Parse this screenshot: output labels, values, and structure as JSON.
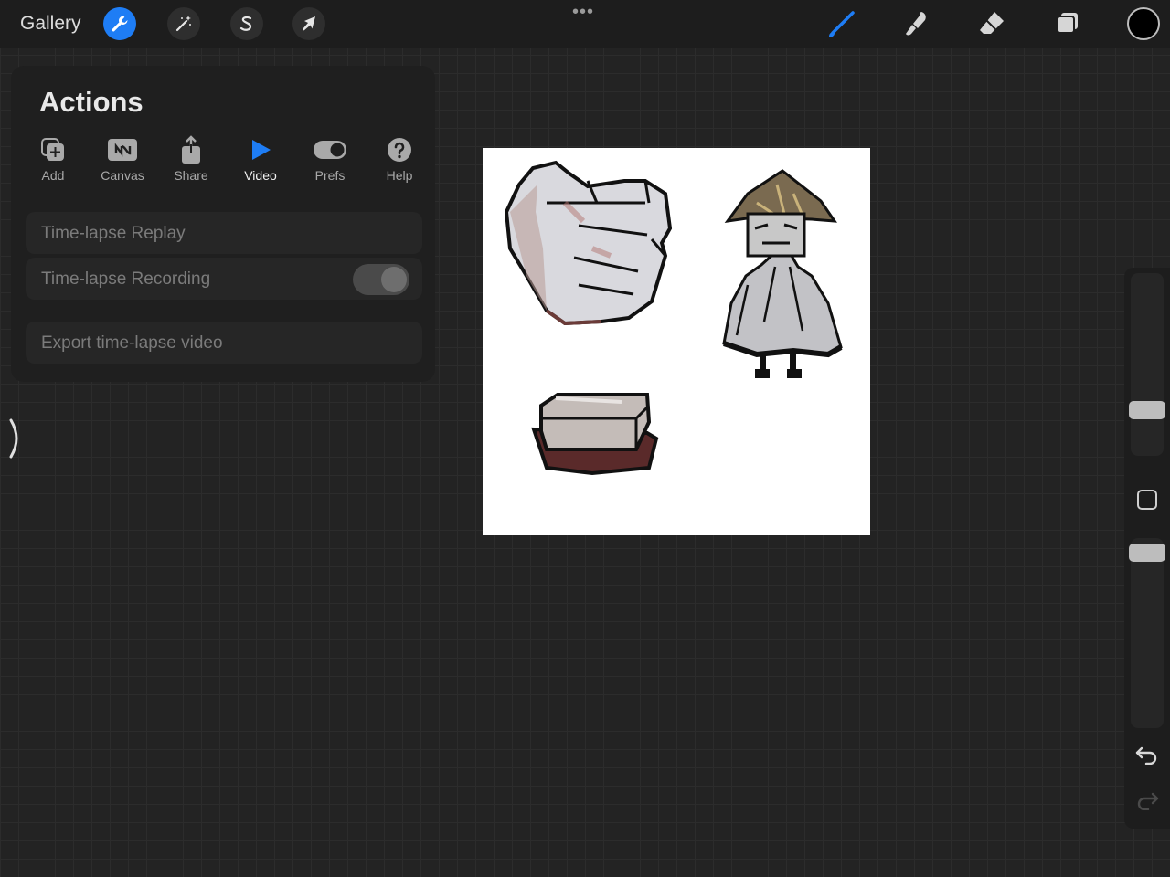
{
  "topbar": {
    "gallery_label": "Gallery",
    "left_tools": [
      {
        "name": "actions",
        "icon": "wrench-icon",
        "active": true
      },
      {
        "name": "adjustments",
        "icon": "magic-wand-icon"
      },
      {
        "name": "selection",
        "icon": "selection-s-icon"
      },
      {
        "name": "transform",
        "icon": "arrow-cursor-icon"
      }
    ],
    "more_label": "•••",
    "right_tools": [
      {
        "name": "brush",
        "icon": "brush-icon",
        "active": true
      },
      {
        "name": "smudge",
        "icon": "smudge-icon"
      },
      {
        "name": "eraser",
        "icon": "eraser-icon"
      },
      {
        "name": "layers",
        "icon": "layers-icon"
      }
    ],
    "current_color": "#000000"
  },
  "actions_panel": {
    "title": "Actions",
    "tabs": [
      {
        "label": "Add",
        "icon": "add-layer-icon"
      },
      {
        "label": "Canvas",
        "icon": "canvas-icon"
      },
      {
        "label": "Share",
        "icon": "share-icon"
      },
      {
        "label": "Video",
        "icon": "play-icon",
        "active": true
      },
      {
        "label": "Prefs",
        "icon": "toggle-icon"
      },
      {
        "label": "Help",
        "icon": "help-icon"
      }
    ],
    "rows": {
      "replay": "Time-lapse Replay",
      "recording": "Time-lapse Recording",
      "export": "Export time-lapse video"
    },
    "recording_enabled": false
  },
  "accent_color": "#1e7df5",
  "canvas": {
    "background": "#ffffff"
  }
}
